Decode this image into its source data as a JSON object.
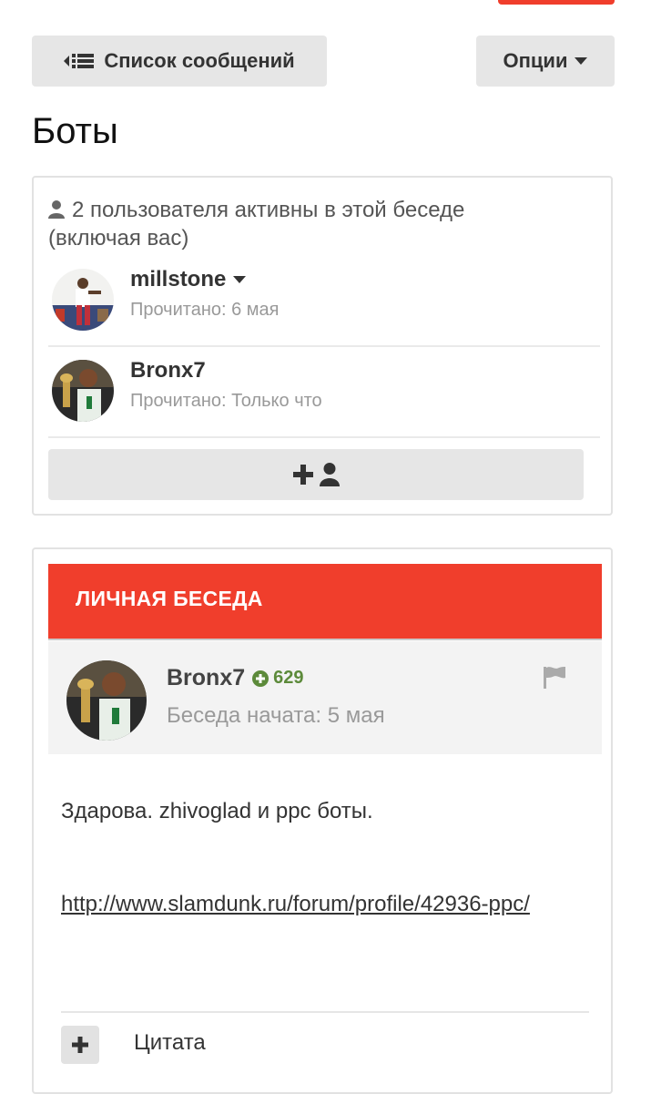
{
  "header": {
    "list_button": "Список сообщений",
    "options_button": "Опции",
    "title": "Боты"
  },
  "participants": {
    "summary": "2 пользователя активны в этой беседе (включая вас)",
    "items": [
      {
        "name": "millstone",
        "read": "Прочитано: 6 мая"
      },
      {
        "name": "Bronx7",
        "read": "Прочитано: Только что"
      }
    ]
  },
  "conversation": {
    "banner": "ЛИЧНАЯ БЕСЕДА",
    "author": "Bronx7",
    "reputation": "629",
    "started": "Беседа начата: 5 мая",
    "text": "Здарова. zhivoglad и ppc боты.",
    "link": "http://www.slamdunk.ru/forum/profile/42936-ppc/",
    "quote_label": "Цитата"
  },
  "colors": {
    "accent": "#f03e2c",
    "reputation": "#5c8a3a"
  }
}
